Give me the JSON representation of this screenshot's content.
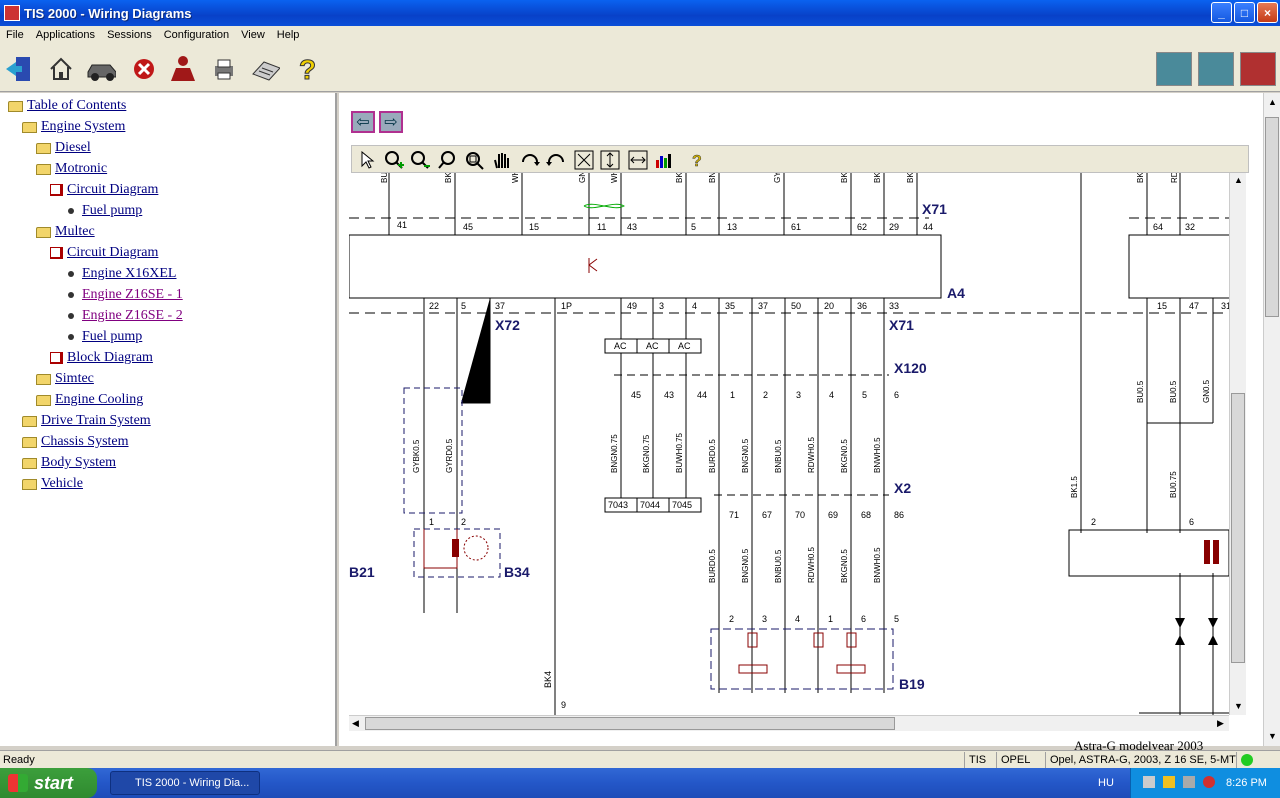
{
  "window": {
    "title": "TIS 2000 - Wiring Diagrams"
  },
  "menu": [
    "File",
    "Applications",
    "Sessions",
    "Configuration",
    "View",
    "Help"
  ],
  "toolbar": {
    "icons": [
      "exit-icon",
      "home-icon",
      "vehicle-icon",
      "stop-icon",
      "user-icon",
      "print-icon",
      "keyboard-icon",
      "help-icon"
    ],
    "right_icons": [
      "module-1-icon",
      "module-2-icon",
      "module-3-icon"
    ]
  },
  "tree": [
    {
      "label": "Table of Contents",
      "type": "folder",
      "level": 0
    },
    {
      "label": "Engine System",
      "type": "folder",
      "level": 1
    },
    {
      "label": "Diesel",
      "type": "folder",
      "level": 2
    },
    {
      "label": "Motronic",
      "type": "folder",
      "level": 2
    },
    {
      "label": "Circuit Diagram",
      "type": "book",
      "level": 3
    },
    {
      "label": "Fuel pump",
      "type": "bullet",
      "level": 4
    },
    {
      "label": "Multec",
      "type": "folder",
      "level": 2
    },
    {
      "label": "Circuit Diagram",
      "type": "book",
      "level": 3
    },
    {
      "label": "Engine X16XEL",
      "type": "bullet",
      "level": 4
    },
    {
      "label": "Engine Z16SE - 1",
      "type": "bullet",
      "level": 4,
      "visited": true
    },
    {
      "label": "Engine Z16SE - 2",
      "type": "bullet",
      "level": 4,
      "visited": true
    },
    {
      "label": "Fuel pump",
      "type": "bullet",
      "level": 4
    },
    {
      "label": "Block Diagram",
      "type": "book",
      "level": 3
    },
    {
      "label": "Simtec",
      "type": "folder",
      "level": 2
    },
    {
      "label": "Engine Cooling",
      "type": "folder",
      "level": 2
    },
    {
      "label": "Drive Train System",
      "type": "folder",
      "level": 1
    },
    {
      "label": "Chassis System",
      "type": "folder",
      "level": 1
    },
    {
      "label": "Body System",
      "type": "folder",
      "level": 1
    },
    {
      "label": "Vehicle",
      "type": "folder",
      "level": 1
    }
  ],
  "viewer": {
    "nav_back": "⇦",
    "nav_forward": "⇨",
    "tools": [
      "pointer-icon",
      "zoom-in-icon",
      "zoom-out-icon",
      "zoom-icon",
      "zoom-area-icon",
      "pan-icon",
      "rotate-cw-icon",
      "rotate-ccw-icon",
      "fit-page-icon",
      "fit-height-icon",
      "fit-width-icon",
      "color-icon",
      "help-icon"
    ],
    "partial_text": "Astra-G modelyear 2003"
  },
  "diagram": {
    "connectors": [
      "X71",
      "A4",
      "X72",
      "X71",
      "X120",
      "X2",
      "B34",
      "B19",
      "B21"
    ],
    "top_wire_colors": [
      "BU",
      "BK",
      "WH",
      "GN",
      "WH",
      "BK",
      "BN",
      "GY",
      "BK",
      "BK",
      "BK",
      "BK",
      "RD"
    ],
    "top_pins": [
      "41",
      "45",
      "15",
      "11",
      "43",
      "5",
      "13",
      "61",
      "62",
      "29",
      "44",
      "64",
      "32"
    ],
    "mid_pins": [
      "22",
      "5",
      "37",
      "1P",
      "49",
      "3",
      "4",
      "35",
      "37",
      "50",
      "20",
      "36",
      "33",
      "15",
      "47",
      "31"
    ],
    "ac_labels": [
      "AC",
      "AC",
      "AC"
    ],
    "x120_pins": [
      "45",
      "43",
      "44",
      "1",
      "2",
      "3",
      "4",
      "5",
      "6"
    ],
    "wires_mid": [
      "BNGN0.75",
      "BKGN0.75",
      "BUWH0.75",
      "BURD0.5",
      "BNGN0.5",
      "BNBU0.5",
      "RDWH0.5",
      "BKGN0.5",
      "BNWH0.5",
      "GYBK0.5",
      "GYRD0.5",
      "BU0.5",
      "BU0.5",
      "GN0.5",
      "BK1.5",
      "BU0.75"
    ],
    "splice_labels": [
      "7043",
      "7044",
      "7045"
    ],
    "x2_pins": [
      "71",
      "67",
      "70",
      "69",
      "68",
      "86"
    ],
    "wires_low": [
      "BURD0.5",
      "BNGN0.5",
      "BNBU0.5",
      "RDWH0.5",
      "BKGN0.5",
      "BNWH0.5"
    ],
    "b19_pins": [
      "2",
      "3",
      "4",
      "1",
      "6",
      "5"
    ],
    "b34_pins": [
      "1",
      "2"
    ],
    "misc_labels": [
      "BK4",
      "9",
      "2",
      "6"
    ]
  },
  "status": {
    "left": "Ready",
    "cells": [
      "TIS",
      "OPEL",
      "Opel, ASTRA-G, 2003, Z 16 SE, 5-MT"
    ]
  },
  "taskbar": {
    "start": "start",
    "task": "TIS 2000 - Wiring Dia...",
    "lang": "HU",
    "time": "8:26 PM"
  }
}
